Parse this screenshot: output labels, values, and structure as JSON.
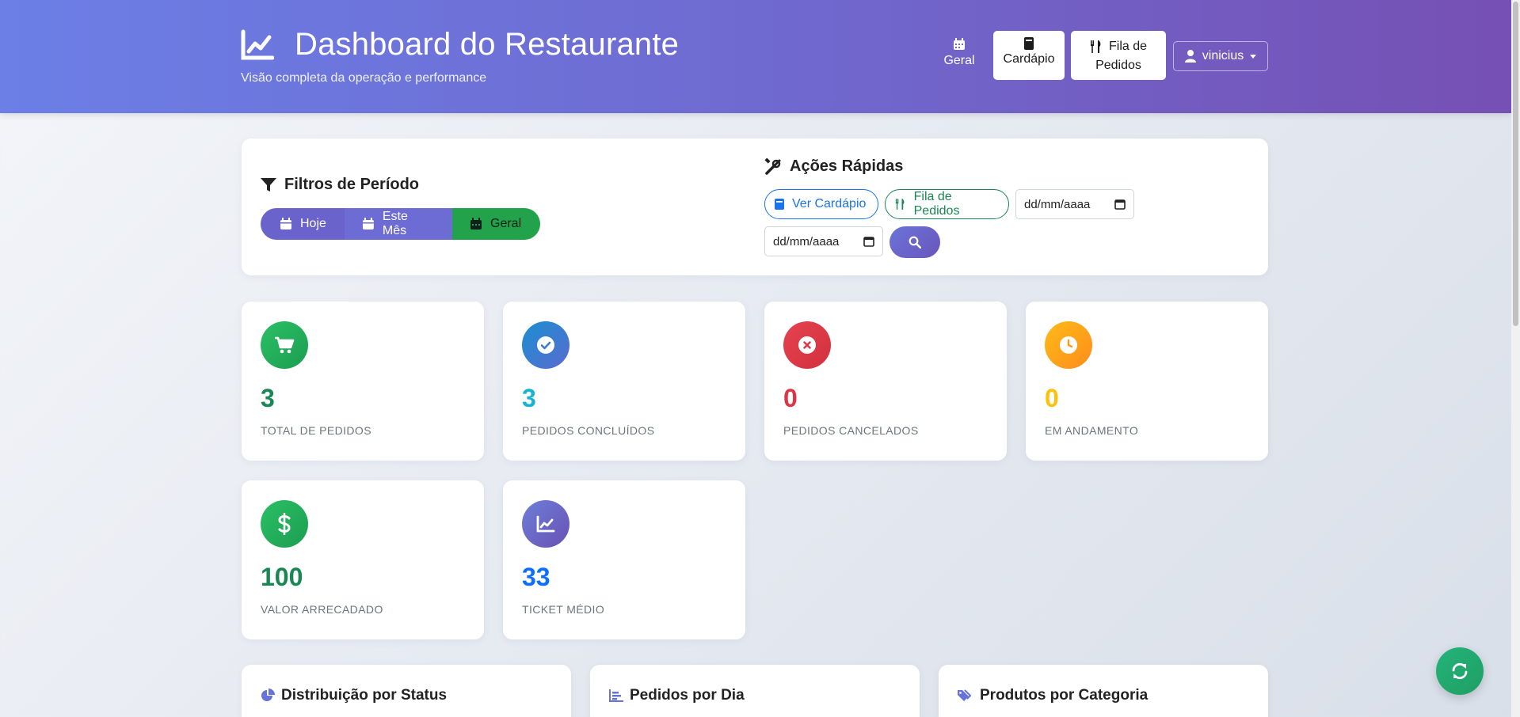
{
  "header": {
    "title": "Dashboard do Restaurante",
    "subtitle": "Visão completa da operação e performance",
    "nav": {
      "geral": "Geral",
      "cardapio": "Cardápio",
      "fila_line1": "Fila de",
      "fila_line2": "Pedidos"
    },
    "user": "vinicius"
  },
  "filters": {
    "title": "Filtros de Período",
    "buttons": {
      "hoje": "Hoje",
      "mes": "Este Mês",
      "geral": "Geral"
    }
  },
  "quick_actions": {
    "title": "Ações Rápidas",
    "ver_cardapio": "Ver Cardápio",
    "fila_pedidos": "Fila de Pedidos",
    "date_start_placeholder": "dd/mm/aaaa",
    "date_end_placeholder": "dd/mm/aaaa"
  },
  "stats": [
    {
      "value": "3",
      "label": "TOTAL DE PEDIDOS",
      "icon": "cart-icon",
      "color": "#198754"
    },
    {
      "value": "3",
      "label": "PEDIDOS CONCLUÍDOS",
      "icon": "check-circle-icon",
      "color": "#17b3d4"
    },
    {
      "value": "0",
      "label": "PEDIDOS CANCELADOS",
      "icon": "x-circle-icon",
      "color": "#dc3545"
    },
    {
      "value": "0",
      "label": "EM ANDAMENTO",
      "icon": "clock-icon",
      "color": "#ffc107"
    },
    {
      "value": "100",
      "label": "VALOR ARRECADADO",
      "icon": "dollar-icon",
      "color": "#198754"
    },
    {
      "value": "33",
      "label": "TICKET MÉDIO",
      "icon": "chart-line-icon",
      "color": "#0d6efd"
    }
  ],
  "sections": {
    "status": "Distribuição por Status",
    "por_dia": "Pedidos por Dia",
    "categoria": "Produtos por Categoria"
  }
}
